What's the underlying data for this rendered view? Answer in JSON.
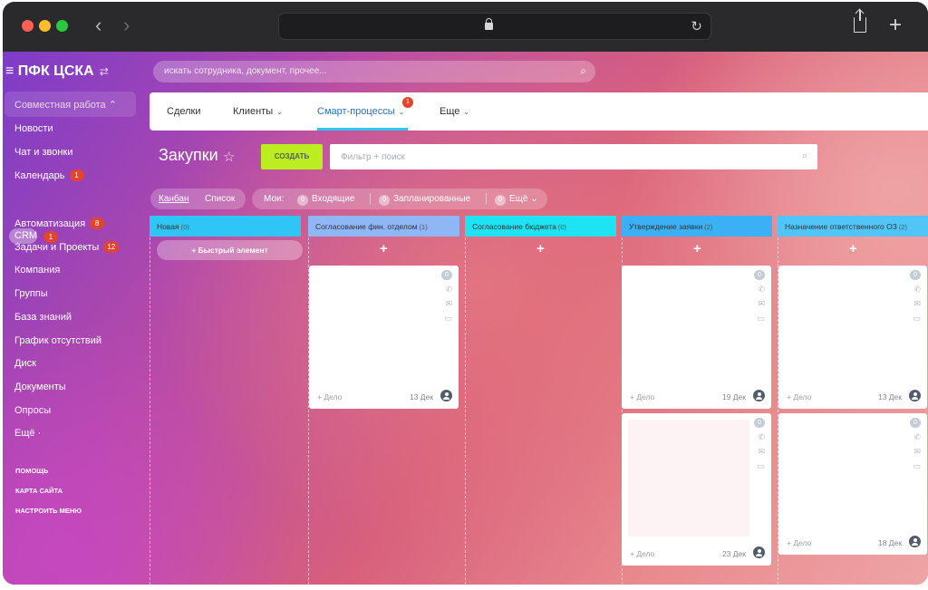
{
  "browser": {
    "back_glyph": "‹",
    "forward_glyph": "›",
    "reload_glyph": "↻",
    "new_tab_glyph": "+",
    "icons": [
      "close-dot",
      "minimize-dot",
      "zoom-dot",
      "back-icon",
      "forward-icon",
      "lock-icon",
      "reload-icon",
      "share-icon",
      "new-tab-icon"
    ]
  },
  "header": {
    "logo": "≡ ПФК ЦСКА",
    "switch_glyph": "⇄",
    "search_placeholder": "искать сотрудника, документ, прочее...",
    "search_glyph": "⌕"
  },
  "sidebar": {
    "group_label": "Совместная работа ⌃",
    "items": [
      {
        "label": "Новости",
        "badge": ""
      },
      {
        "label": "Чат и звонки",
        "badge": ""
      },
      {
        "label": "Календарь",
        "badge": "1"
      },
      {
        "label": "CRM",
        "badge": "1"
      },
      {
        "label": "Автоматизация",
        "badge": "8"
      },
      {
        "label": "Задачи и Проекты",
        "badge": "12"
      },
      {
        "label": "Компания",
        "badge": ""
      },
      {
        "label": "Группы",
        "badge": ""
      },
      {
        "label": "База знаний",
        "badge": ""
      },
      {
        "label": "График отсутствий",
        "badge": ""
      },
      {
        "label": "Диск",
        "badge": ""
      },
      {
        "label": "Документы",
        "badge": ""
      },
      {
        "label": "Опросы",
        "badge": ""
      },
      {
        "label": "Ещё ·",
        "badge": ""
      }
    ],
    "footer": [
      "ПОМОЩЬ",
      "КАРТА САЙТА",
      "НАСТРОИТЬ МЕНЮ"
    ]
  },
  "tabs": [
    {
      "label": "Сделки",
      "chevron": ""
    },
    {
      "label": "Клиенты",
      "chevron": "⌄"
    },
    {
      "label": "Смарт-процессы",
      "chevron": "⌄",
      "active": true,
      "badge": "1"
    },
    {
      "label": "Еще",
      "chevron": "⌄"
    }
  ],
  "toolbar": {
    "title": "Закупки",
    "star_glyph": "☆",
    "create_label": "СОЗДАТЬ",
    "filter_placeholder": "Фильтр + поиск",
    "filter_glyph": "⌕"
  },
  "views": {
    "kanban": "Канбан",
    "list": "Список"
  },
  "mine": {
    "label": "Мои:",
    "items": [
      {
        "count": "0",
        "label": "Входящие"
      },
      {
        "count": "0",
        "label": "Запланированные"
      },
      {
        "count": "0",
        "label": "Ещё ⌄"
      }
    ]
  },
  "columns": [
    {
      "title": "Новая",
      "count": "(0)",
      "color": "#2fc6f6"
    },
    {
      "title": "Согласование фин. отделом",
      "count": "(1)",
      "color": "#8fb7f6"
    },
    {
      "title": "Согласование бюджета",
      "count": "(0)",
      "color": "#1ee3f2"
    },
    {
      "title": "Утверждение заявки",
      "count": "(2)",
      "color": "#3bb0f4"
    },
    {
      "title": "Назначение ответственного ОЗ",
      "count": "(2)",
      "color": "#52c5f8"
    }
  ],
  "quick_add": "+ Быстрый элемент",
  "add_glyph": "+",
  "card_icons": {
    "count": "0",
    "phone": "✆",
    "mail": "✉",
    "comment": "▭"
  },
  "cards": [
    {
      "deal": "+ Дело",
      "date": "13 Дек"
    },
    {
      "deal": "+ Дело",
      "date": "19 Дек"
    },
    {
      "deal": "+ Дело",
      "date": "23 Дек"
    },
    {
      "deal": "+ Дело",
      "date": "13 Дек"
    },
    {
      "deal": "+ Дело",
      "date": "18 Дек"
    }
  ]
}
